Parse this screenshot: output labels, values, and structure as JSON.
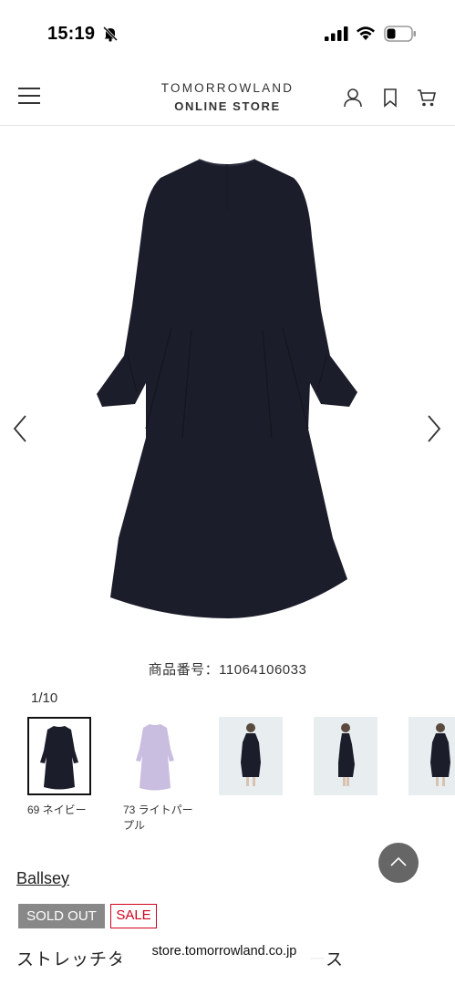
{
  "status_bar": {
    "time": "15:19",
    "icons": [
      "bell-off-icon",
      "signal-icon",
      "wifi-icon",
      "battery-icon"
    ]
  },
  "header": {
    "brand_line1": "TOMORROWLAND",
    "brand_line2": "ONLINE STORE",
    "icons": [
      "menu-icon",
      "user-icon",
      "bookmark-icon",
      "cart-icon"
    ]
  },
  "gallery": {
    "product_number": "商品番号：11064106033",
    "page_counter": "1/10",
    "dress_color": "#1c1d2b"
  },
  "thumbnails": [
    {
      "label": "69 ネイビー",
      "selected": true
    },
    {
      "label": "73 ライトパープル",
      "selected": false
    },
    {
      "label": "",
      "selected": false
    },
    {
      "label": "",
      "selected": false
    },
    {
      "label": "",
      "selected": false
    }
  ],
  "product": {
    "brand": "Ballsey",
    "badge_soldout": "SOLD OUT",
    "badge_sale": "SALE",
    "title": "ストレッチタ　　　　　　　　　　ース"
  },
  "browser": {
    "url": "store.tomorrowland.co.jp"
  },
  "colors": {
    "sale_red": "#d0021b",
    "soldout_gray": "#888888",
    "navy": "#1c1d2b",
    "lavender": "#c9bde0"
  }
}
